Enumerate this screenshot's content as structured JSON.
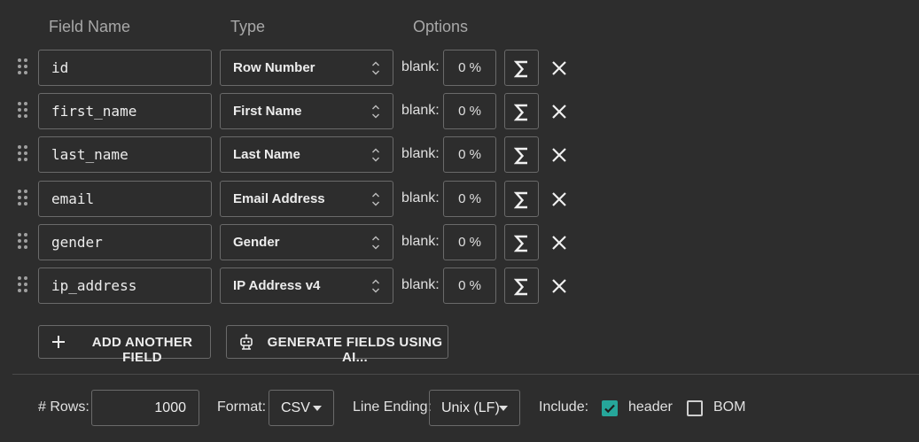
{
  "headers": {
    "name": "Field Name",
    "type": "Type",
    "options": "Options"
  },
  "fields": [
    {
      "name": "id",
      "type": "Row Number",
      "blank_label": "blank:",
      "blank_value": "0 %"
    },
    {
      "name": "first_name",
      "type": "First Name",
      "blank_label": "blank:",
      "blank_value": "0 %"
    },
    {
      "name": "last_name",
      "type": "Last Name",
      "blank_label": "blank:",
      "blank_value": "0 %"
    },
    {
      "name": "email",
      "type": "Email Address",
      "blank_label": "blank:",
      "blank_value": "0 %"
    },
    {
      "name": "gender",
      "type": "Gender",
      "blank_label": "blank:",
      "blank_value": "0 %"
    },
    {
      "name": "ip_address",
      "type": "IP Address v4",
      "blank_label": "blank:",
      "blank_value": "0 %"
    }
  ],
  "actions": {
    "add_field": "ADD ANOTHER FIELD",
    "generate_ai": "GENERATE FIELDS USING AI..."
  },
  "footer": {
    "rows_label": "# Rows:",
    "rows_value": "1000",
    "format_label": "Format:",
    "format_value": "CSV",
    "line_ending_label": "Line Ending:",
    "line_ending_value": "Unix (LF)",
    "include_label": "Include:",
    "header_label": "header",
    "header_checked": true,
    "bom_label": "BOM",
    "bom_checked": false
  },
  "colors": {
    "background": "#2d2d2d",
    "accent": "#26a69a",
    "border": "#6a6a6a"
  },
  "icons": [
    "drag-handle-icon",
    "chevron-updown-icon",
    "sigma-icon",
    "close-icon",
    "plus-icon",
    "robot-icon",
    "caret-down-icon",
    "checkmark-icon"
  ]
}
